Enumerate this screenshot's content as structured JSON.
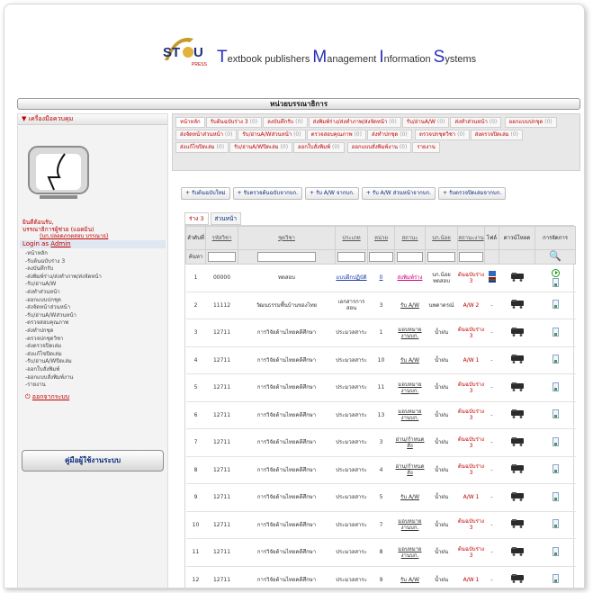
{
  "brand": {
    "letters": [
      "T",
      "extbook publishers ",
      "M",
      "anagement ",
      "I",
      "nformation ",
      "S",
      "ystems"
    ],
    "logo_text": "ST U",
    "logo_sub": "PRESS"
  },
  "page_title": "หน่วยบรรณาธิการ",
  "sidebar": {
    "header": "▼ เครื่องมือควบคุม",
    "welcome_line1": "ยินดีต้อนรับ,",
    "welcome_line2": "บรรณาธิการผู้ช่วย (แอดมิน)",
    "account_link": "(บก.ปลอดภกตสอบ บรรณาธ)",
    "login_prefix": "Login as ",
    "login_user": "Admin",
    "menu": [
      "-หน้าหลัก",
      "-รับต้นฉบับร่าง 3",
      "-ลงบันทึกรับ",
      "-ส่งพิมพ์ร่าง/ส่งทำภาพ/ส่งจัดหน้า",
      "-รับ/อ่านA/W",
      "-ส่งทำส่วนหน้า",
      "-ออกแบบปกชุด",
      "-ส่งจัดหน้าส่วนหน้า",
      "-รับ/อ่านA/Wส่วนหน้า",
      "-ตรวจสอบคุณภาพ",
      "-ส่งทำปกชุด",
      "-ตรวจปกชุดวิชา",
      "-ส่งตรวจปิดเล่ม",
      "-ส่งแก้ไขปิดเล่ม",
      "-รับ/อ่านA/Wปิดเล่ม",
      "-ออกใบสั่งพิมพ์",
      "-ออกแบบสั่งพิมพ์งาน",
      "-รายงาน"
    ],
    "logout": "ออกจากระบบ",
    "manual_button": "คู่มือผู้ใช้งานระบบ"
  },
  "tabs": [
    {
      "label": "หน้าหลัก",
      "count": ""
    },
    {
      "label": "รับต้นฉบับร่าง 3",
      "count": "(0)"
    },
    {
      "label": "ลงบันทึกรับ",
      "count": "(0)"
    },
    {
      "label": "ส่งพิมพ์ร่าง/ส่งทำภาพ/ส่งจัดหน้า",
      "count": "(0)"
    },
    {
      "label": "รับ/อ่านA/W",
      "count": "(0)"
    },
    {
      "label": "ส่งทำส่วนหน้า",
      "count": "(0)"
    },
    {
      "label": "ออกแบบปกชุด",
      "count": "(0)"
    },
    {
      "label": "ส่งจัดหน้าส่วนหน้า",
      "count": "(0)"
    },
    {
      "label": "รับ/อ่านA/Wส่วนหน้า",
      "count": "(0)"
    },
    {
      "label": "ตรวจสอบคุณภาพ",
      "count": "(0)"
    },
    {
      "label": "ส่งทำปกชุด",
      "count": "(0)"
    },
    {
      "label": "ตรวจปกชุดวิชา",
      "count": "(0)"
    },
    {
      "label": "ส่งตรวจปิดเล่ม",
      "count": "(0)"
    },
    {
      "label": "ส่งแก้ไขปิดเล่ม",
      "count": "(0)"
    },
    {
      "label": "รับ/อ่านA/Wปิดเล่ม",
      "count": "(0)"
    },
    {
      "label": "ออกใบสั่งพิมพ์",
      "count": "(0)"
    },
    {
      "label": "ออกแบบสั่งพิมพ์งาน",
      "count": "(0)"
    },
    {
      "label": "รายงาน",
      "count": ""
    }
  ],
  "toolbar": [
    "+ รับต้นฉบับใหม่",
    "+ รับตรวจต้นฉบับจากบก.",
    "+ รับ A/W จากบก.",
    "+ รับ A/W ส่วนหน้าจากบก.",
    "+ รับตรวจปิดเล่มจากบก."
  ],
  "subtabs": [
    {
      "label": "ร่าง 3",
      "count": ""
    },
    {
      "label": "ส่วนหน้า",
      "count": ""
    }
  ],
  "table": {
    "headers": [
      "ลำดับที่",
      "รหัสวิชา",
      "ชุดวิชา",
      "ประเภท",
      "หน่วย",
      "สถานะ",
      "บก.น้อย",
      "สถานะงาน",
      "ไฟล์",
      "ดาวน์โหลด",
      "การจัดการ"
    ],
    "filter_first": "ค้นหา",
    "rows": [
      [
        "1",
        "00000",
        "ทดสอบ",
        "แบบฝึกปฏิบัติ",
        "0",
        "ส่งพิมพ์ร่าง",
        "บก.น้อยทดสอบ",
        "ต้นฉบับร่าง 3"
      ],
      [
        "2",
        "11112",
        "วัฒนธรรมพื้นบ้านของไทย",
        "เอกสารการสอน",
        "3",
        "รับ A/W",
        "นพดาตรณ์",
        "A/W 2"
      ],
      [
        "3",
        "12711",
        "การวิจัยด้านไทยคดีศึกษา",
        "ประมวลสาระ",
        "1",
        "มอบหมายงานบก.",
        "น้ำฝน",
        "ต้นฉบับร่าง 3"
      ],
      [
        "4",
        "12711",
        "การวิจัยด้านไทยคดีศึกษา",
        "ประมวลสาระ",
        "10",
        "รับ A/W",
        "น้ำฝน",
        "A/W 1"
      ],
      [
        "5",
        "12711",
        "การวิจัยด้านไทยคดีศึกษา",
        "ประมวลสาระ",
        "11",
        "มอบหมายงานบก.",
        "น้ำฝน",
        "ต้นฉบับร่าง 3"
      ],
      [
        "6",
        "12711",
        "การวิจัยด้านไทยคดีศึกษา",
        "ประมวลสาระ",
        "13",
        "มอบหมายงานบก.",
        "น้ำฝน",
        "ต้นฉบับร่าง 3"
      ],
      [
        "7",
        "12711",
        "การวิจัยด้านไทยคดีศึกษา",
        "ประมวลสาระ",
        "3",
        "อ่าน/กำหนดสั่ง",
        "น้ำฝน",
        "ต้นฉบับร่าง 3"
      ],
      [
        "8",
        "12711",
        "การวิจัยด้านไทยคดีศึกษา",
        "ประมวลสาระ",
        "4",
        "อ่าน/กำหนดสั่ง",
        "น้ำฝน",
        "ต้นฉบับร่าง 3"
      ],
      [
        "9",
        "12711",
        "การวิจัยด้านไทยคดีศึกษา",
        "ประมวลสาระ",
        "5",
        "รับ A/W",
        "น้ำฝน",
        "A/W 1"
      ],
      [
        "10",
        "12711",
        "การวิจัยด้านไทยคดีศึกษา",
        "ประมวลสาระ",
        "7",
        "มอบหมายงานบก.",
        "น้ำฝน",
        "ต้นฉบับร่าง 3"
      ],
      [
        "11",
        "12711",
        "การวิจัยด้านไทยคดีศึกษา",
        "ประมวลสาระ",
        "8",
        "มอบหมายงานบก.",
        "น้ำฝน",
        "ต้นฉบับร่าง 3"
      ],
      [
        "12",
        "12711",
        "การวิจัยด้านไทยคดีศึกษา",
        "ประมวลสาระ",
        "9",
        "รับ A/W",
        "น้ำฝน",
        "A/W 1"
      ]
    ],
    "dash": "-"
  }
}
